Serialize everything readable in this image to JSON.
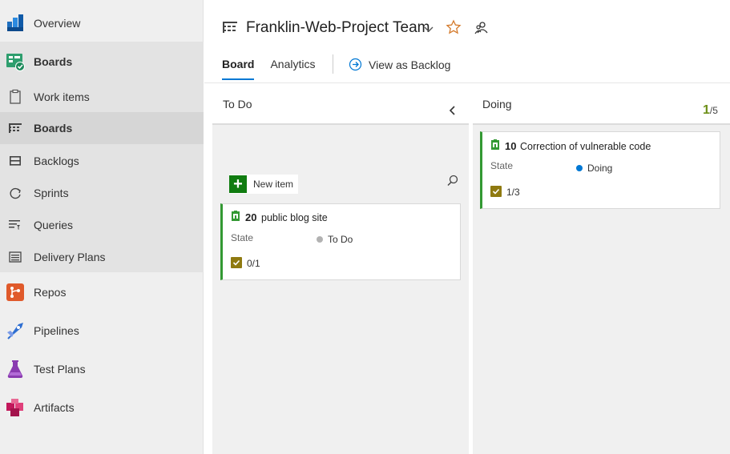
{
  "sidebar": {
    "overview": "Overview",
    "boards": "Boards",
    "work_items": "Work items",
    "boards_sub": "Boards",
    "backlogs": "Backlogs",
    "sprints": "Sprints",
    "queries": "Queries",
    "delivery_plans": "Delivery Plans",
    "repos": "Repos",
    "pipelines": "Pipelines",
    "test_plans": "Test Plans",
    "artifacts": "Artifacts"
  },
  "header": {
    "team": "Franklin-Web-Project Team",
    "tabs": [
      "Board",
      "Analytics"
    ],
    "view_backlog": "View as Backlog"
  },
  "board": {
    "columns": [
      {
        "name": "To Do",
        "new_item": "New item",
        "cards": [
          {
            "id": "20",
            "title": "public blog site",
            "state_label": "State",
            "state": "To Do",
            "checklist": "0/1"
          }
        ]
      },
      {
        "name": "Doing",
        "wip_current": "1",
        "wip_limit": "/5",
        "cards": [
          {
            "id": "10",
            "title": "Correction of vulnerable code",
            "state_label": "State",
            "state": "Doing",
            "checklist": "1/3"
          }
        ]
      }
    ]
  },
  "colors": {
    "accent": "#0078d4",
    "card_bar": "#339933",
    "todo_dot": "#b2b2b2",
    "doing_dot": "#0078d4",
    "checklist": "#8f7a10",
    "new_item": "#107c10"
  }
}
